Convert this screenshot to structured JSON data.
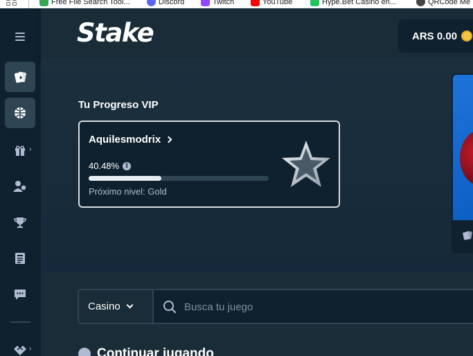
{
  "bookmarks": [
    {
      "label": "Free File Search Tool...",
      "icon": "green-doc-icon",
      "color": "#34a853"
    },
    {
      "label": "Discord",
      "icon": "discord-icon",
      "color": "#5865f2"
    },
    {
      "label": "Twitch",
      "icon": "twitch-icon",
      "color": "#9146ff"
    },
    {
      "label": "YouTube",
      "icon": "youtube-icon",
      "color": "#ff0000"
    },
    {
      "label": "Hype.Bet Casino en...",
      "icon": "hype-icon",
      "color": "#22c55e"
    },
    {
      "label": "QRCode Me",
      "icon": "qrcode-icon",
      "color": "#444444"
    }
  ],
  "header": {
    "logo": "Stake",
    "wallet_amount": "ARS 0.00"
  },
  "sidebar": {
    "items": [
      {
        "icon": "casino-cards-icon",
        "chevron": false
      },
      {
        "icon": "sports-ball-icon",
        "chevron": false
      },
      {
        "icon": "gift-icon",
        "chevron": true
      },
      {
        "icon": "affiliate-users-icon",
        "chevron": false
      },
      {
        "icon": "trophy-icon",
        "chevron": false
      },
      {
        "icon": "news-icon",
        "chevron": false
      },
      {
        "icon": "chat-icon",
        "chevron": false
      },
      {
        "icon": "sponsorship-icon",
        "chevron": true
      }
    ]
  },
  "vip": {
    "title": "Tu Progreso VIP",
    "username": "Aquilesmodrix",
    "progress_label": "40.48%",
    "progress": 40.48,
    "next_level": "Próximo nivel: Gold"
  },
  "search": {
    "category": "Casino",
    "placeholder": "Busca tu juego"
  },
  "continue": {
    "title": "Continuar jugando"
  },
  "colors": {
    "bg": "#1a2c38",
    "sidebar": "#0f212e",
    "border": "#2f4553",
    "muted": "#b1bad3"
  }
}
